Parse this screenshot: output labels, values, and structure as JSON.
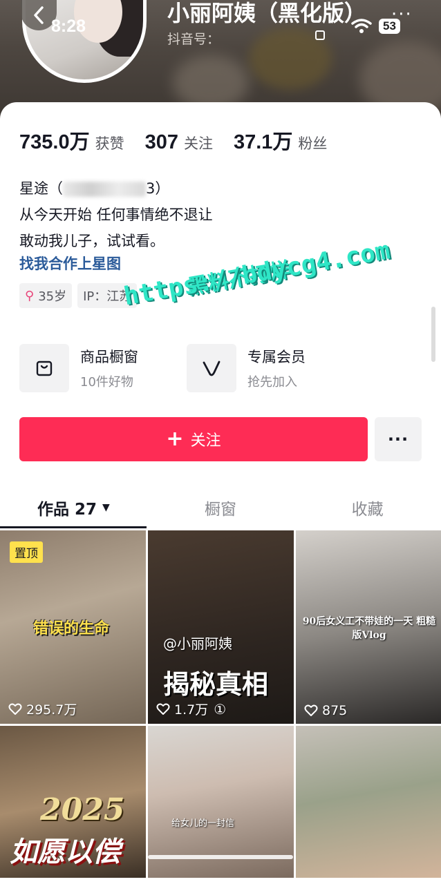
{
  "status_bar": {
    "time": "8:28",
    "battery": "53"
  },
  "header": {
    "profile_name": "小丽阿姨（黑化版）",
    "douyin_id_label": "抖音号：",
    "more_glyph": "···"
  },
  "stats": [
    {
      "value": "735.0万",
      "label": "获赞"
    },
    {
      "value": "307",
      "label": "关注"
    },
    {
      "value": "37.1万",
      "label": "粉丝"
    }
  ],
  "bio": {
    "line1_prefix": "星途（",
    "line1_suffix": "3）",
    "line2": "从今天开始 任何事情绝不退让",
    "line3": "敢动我儿子，试试看。",
    "link": "找我合作上星图"
  },
  "tags": {
    "age": "35岁",
    "ip": "IP：江苏"
  },
  "watermark": {
    "line1": "黑料不打烊",
    "line2": "https://bdycg4.com"
  },
  "features": [
    {
      "title": "商品橱窗",
      "subtitle": "10件好物",
      "icon": "shopping-bag-icon"
    },
    {
      "title": "专属会员",
      "subtitle": "抢先加入",
      "icon": "v-member-icon"
    }
  ],
  "actions": {
    "follow_label": "关注",
    "more_label": "···"
  },
  "tabs": [
    {
      "label": "作品 27",
      "active": true
    },
    {
      "label": "橱窗",
      "active": false
    },
    {
      "label": "收藏",
      "active": false
    }
  ],
  "videos": [
    {
      "pinned_label": "置顶",
      "caption": "错误的生命",
      "likes": "295.7万"
    },
    {
      "caption_at": "@小丽阿姨",
      "caption": "揭秘真相",
      "likes": "1.7万",
      "suffix": "①"
    },
    {
      "caption": "90后女义工不带娃的一天 粗糙版Vlog",
      "likes": "875"
    },
    {
      "caption_year": "2025",
      "caption": "如愿以偿"
    },
    {
      "caption": "给女儿的一封信"
    },
    {
      "caption": ""
    }
  ],
  "colors": {
    "follow_button": "#fe2c55",
    "link": "#2b5b9a",
    "pin_badge": "#ffe14d",
    "watermark": "#2fe6c6"
  }
}
